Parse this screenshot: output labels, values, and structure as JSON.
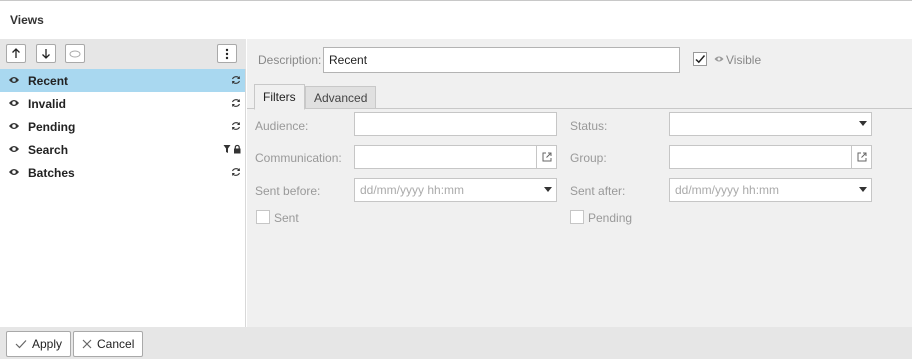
{
  "window": {
    "title": "Views"
  },
  "toolbar": {
    "icons": [
      "arrow-up-icon",
      "arrow-down-icon",
      "ellipse-icon",
      "kebab-menu-icon"
    ]
  },
  "views": [
    {
      "label": "Recent",
      "selected": true,
      "status_icon": "refresh-icon"
    },
    {
      "label": "Invalid",
      "selected": false,
      "status_icon": "refresh-icon"
    },
    {
      "label": "Pending",
      "selected": false,
      "status_icon": "refresh-icon"
    },
    {
      "label": "Search",
      "selected": false,
      "status_icon": "filter-lock-icon"
    },
    {
      "label": "Batches",
      "selected": false,
      "status_icon": "refresh-icon"
    }
  ],
  "details": {
    "description_label": "Description:",
    "description_value": "Recent",
    "visible_label": "Visible",
    "visible_checked": true
  },
  "tabs": [
    {
      "label": "Filters",
      "active": true
    },
    {
      "label": "Advanced",
      "active": false
    }
  ],
  "filters": {
    "audience_label": "Audience:",
    "status_label": "Status:",
    "communication_label": "Communication:",
    "group_label": "Group:",
    "sent_before_label": "Sent before:",
    "sent_before_placeholder": "dd/mm/yyyy hh:mm",
    "sent_after_label": "Sent after:",
    "sent_after_placeholder": "dd/mm/yyyy hh:mm",
    "sent_label": "Sent",
    "pending_label": "Pending"
  },
  "footer": {
    "apply_label": "Apply",
    "cancel_label": "Cancel"
  },
  "colors": {
    "selected_row": "#a9d8f0",
    "panel_bg": "#f0f0f0",
    "toolbar_bg": "#e6e6e6"
  }
}
